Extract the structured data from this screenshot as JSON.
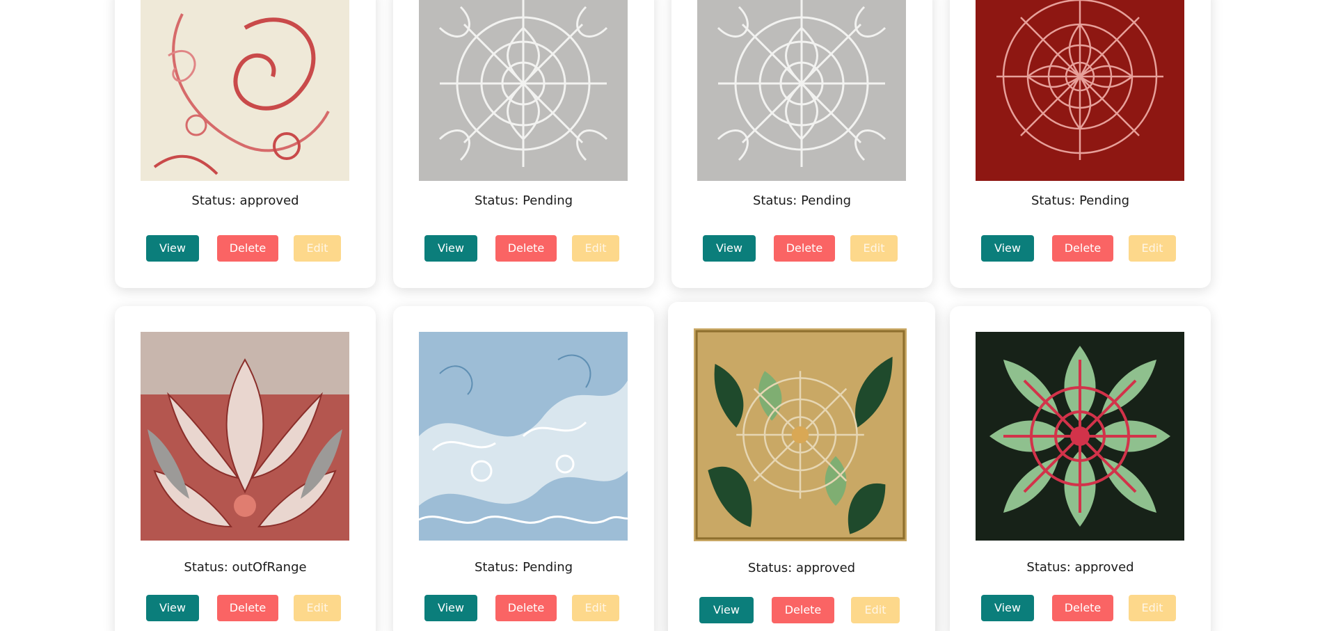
{
  "colors": {
    "view": "#0b7e7b",
    "delete": "#fa6464",
    "edit": "#fdd88b",
    "edit_text": "#fff6e6"
  },
  "buttons": {
    "view": "View",
    "delete": "Delete",
    "edit": "Edit"
  },
  "cards": [
    {
      "status": "Status: approved",
      "image": "red-paisley-lace-on-cream"
    },
    {
      "status": "Status: Pending",
      "image": "white-lace-snowflake-on-grey"
    },
    {
      "status": "Status: Pending",
      "image": "white-lace-snowflake-on-grey"
    },
    {
      "status": "Status: Pending",
      "image": "red-lace-mandala-on-dark-red"
    },
    {
      "status": "Status: outOfRange",
      "image": "red-silver-damask-leaves"
    },
    {
      "status": "Status: Pending",
      "image": "blue-white-lace-waves"
    },
    {
      "status": "Status: approved",
      "image": "gold-green-lace-mandala"
    },
    {
      "status": "Status: approved",
      "image": "red-green-lace-mandala-on-black"
    }
  ]
}
